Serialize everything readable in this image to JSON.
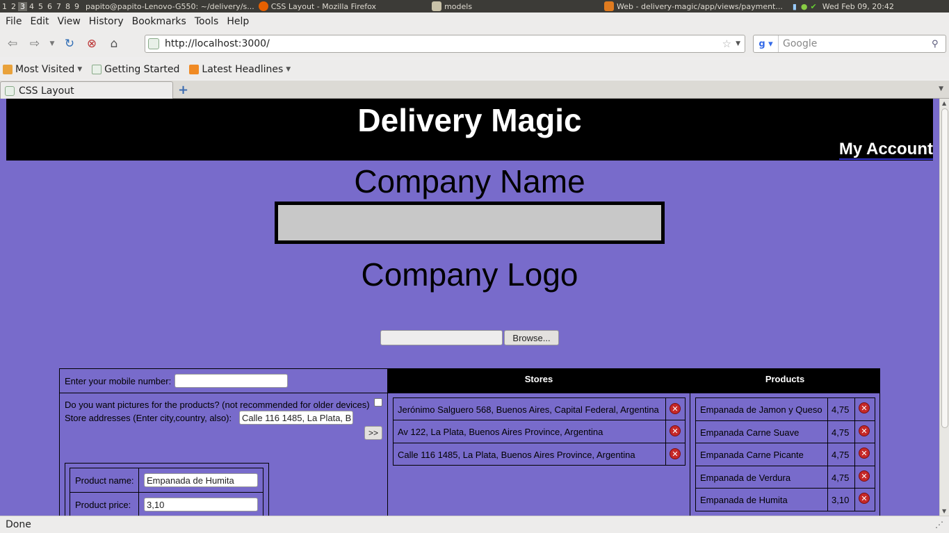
{
  "system_panel": {
    "workspaces": [
      "1",
      "2",
      "3",
      "4",
      "5",
      "6",
      "7",
      "8",
      "9"
    ],
    "active_workspace": "3",
    "tasks": [
      "papito@papito-Lenovo-G550: ~/delivery/s...",
      "CSS Layout - Mozilla Firefox",
      "models",
      "Web - delivery-magic/app/views/payment..."
    ],
    "clock": "Wed Feb 09, 20:42"
  },
  "menubar": {
    "items": [
      "File",
      "Edit",
      "View",
      "History",
      "Bookmarks",
      "Tools",
      "Help"
    ]
  },
  "navbar": {
    "url": "http://localhost:3000/",
    "search_placeholder": "Google"
  },
  "bookmarks": {
    "items": [
      "Most Visited",
      "Getting Started",
      "Latest Headlines"
    ]
  },
  "tabs": {
    "active_label": "CSS Layout"
  },
  "page": {
    "site_title": "Delivery Magic",
    "my_account": "My Account",
    "company_name_label": "Company Name",
    "company_logo_label": "Company Logo",
    "browse_label": "Browse...",
    "mobile_label": "Enter your mobile number:",
    "pictures_label": "Do you want pictures for the products? (not recommended for older devices)",
    "store_address_label": "Store addresses (Enter city,country, also):",
    "store_address_value": "Calle 116 1485, La Plata, B",
    "add_store_label": ">>",
    "product_name_label": "Product name:",
    "product_name_value": "Empanada de Humita",
    "product_price_label": "Product price:",
    "product_price_value": "3,10",
    "stores_header": "Stores",
    "products_header": "Products",
    "stores": [
      "Jerónimo Salguero 568, Buenos Aires, Capital Federal, Argentina",
      "Av 122, La Plata, Buenos Aires Province, Argentina",
      "Calle 116 1485, La Plata, Buenos Aires Province, Argentina"
    ],
    "products": [
      {
        "name": "Empanada de Jamon y Queso",
        "price": "4,75"
      },
      {
        "name": "Empanada Carne Suave",
        "price": "4,75"
      },
      {
        "name": "Empanada Carne Picante",
        "price": "4,75"
      },
      {
        "name": "Empanada de Verdura",
        "price": "4,75"
      },
      {
        "name": "Empanada de Humita",
        "price": "3,10"
      }
    ]
  },
  "statusbar": {
    "text": "Done"
  },
  "colors": {
    "page_bg": "#786bcb",
    "header_bg": "#000000",
    "delete_icon": "#c62828"
  }
}
